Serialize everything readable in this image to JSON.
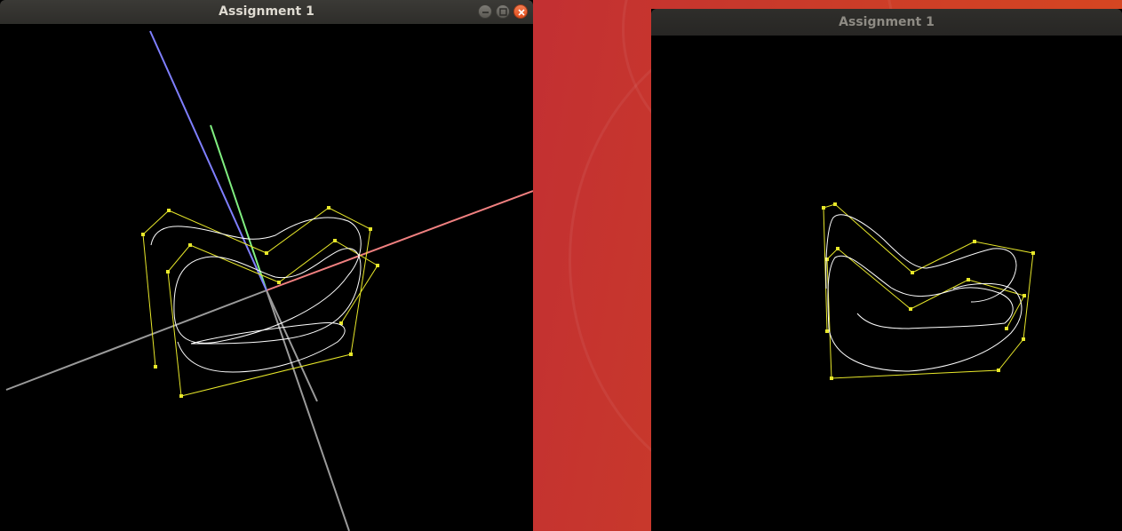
{
  "windows": {
    "left": {
      "title": "Assignment 1",
      "buttons": [
        "minimize",
        "maximize",
        "close"
      ]
    },
    "right": {
      "title": "Assignment 1"
    }
  },
  "colors": {
    "desktop_accent": "#c02b36",
    "canvas_background": "#000000",
    "curve": "#ffffff",
    "control_polygon": "#e8e82a",
    "axis_x": "#f08080",
    "axis_y": "#80ee80",
    "axis_z": "#7f7fff",
    "axis_negative": "#9a9a9a"
  }
}
